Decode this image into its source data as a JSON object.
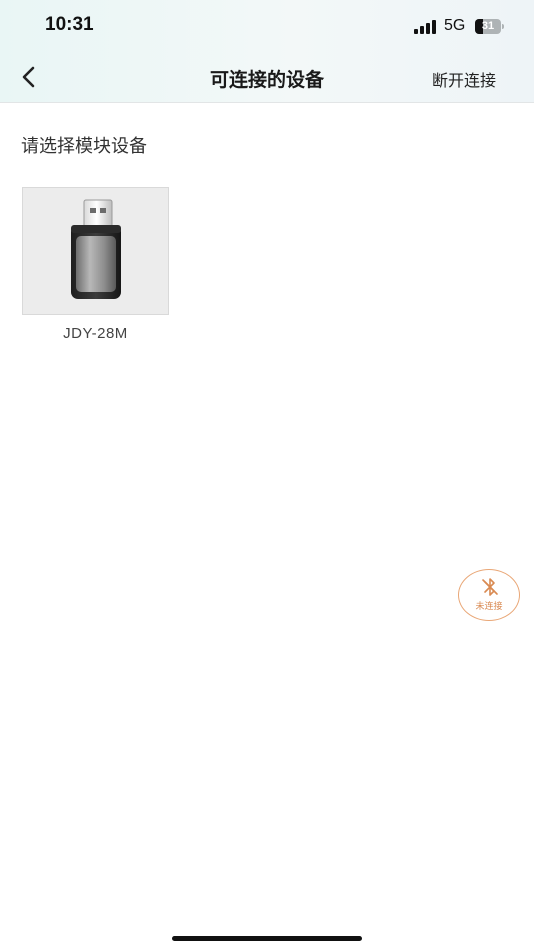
{
  "status_bar": {
    "time": "10:31",
    "network": "5G",
    "battery_level": "31",
    "battery_fraction": 0.31
  },
  "nav": {
    "title": "可连接的设备",
    "disconnect_label": "断开连接",
    "back_icon": "chevron-left-icon"
  },
  "main": {
    "section_title": "请选择模块设备",
    "devices": [
      {
        "name": "JDY-28M",
        "icon": "usb-dongle-icon"
      }
    ]
  },
  "float_status": {
    "label": "未连接",
    "icon": "bluetooth-off-icon",
    "color": "#e9a777"
  }
}
